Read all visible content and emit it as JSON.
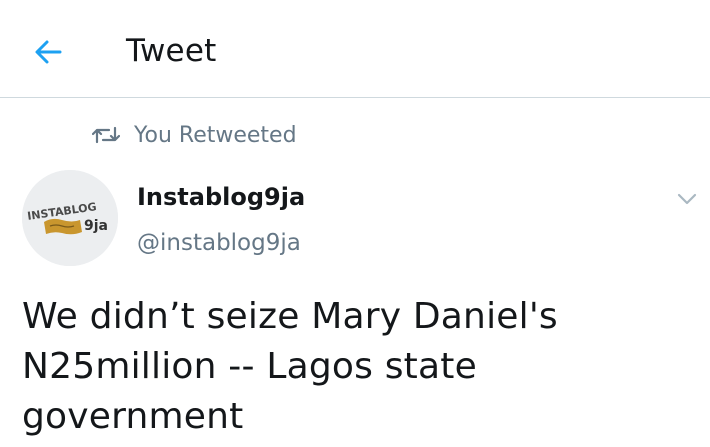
{
  "header": {
    "title": "Tweet",
    "back_icon": "arrow-left-icon"
  },
  "retweet": {
    "label": "You Retweeted",
    "icon": "retweet-icon"
  },
  "tweet": {
    "author_name": "Instablog9ja",
    "author_handle": "@instablog9ja",
    "text": "We didn’t seize Mary Daniel's N25million -- Lagos state government",
    "menu_icon": "chevron-down-icon"
  },
  "avatar": {
    "logo_text_top": "INSTABLOG",
    "logo_text_bottom": "9ja"
  },
  "colors": {
    "accent": "#1da1f2",
    "secondary_text": "#657786",
    "primary_text": "#14171a",
    "divider": "#cfd9de"
  }
}
